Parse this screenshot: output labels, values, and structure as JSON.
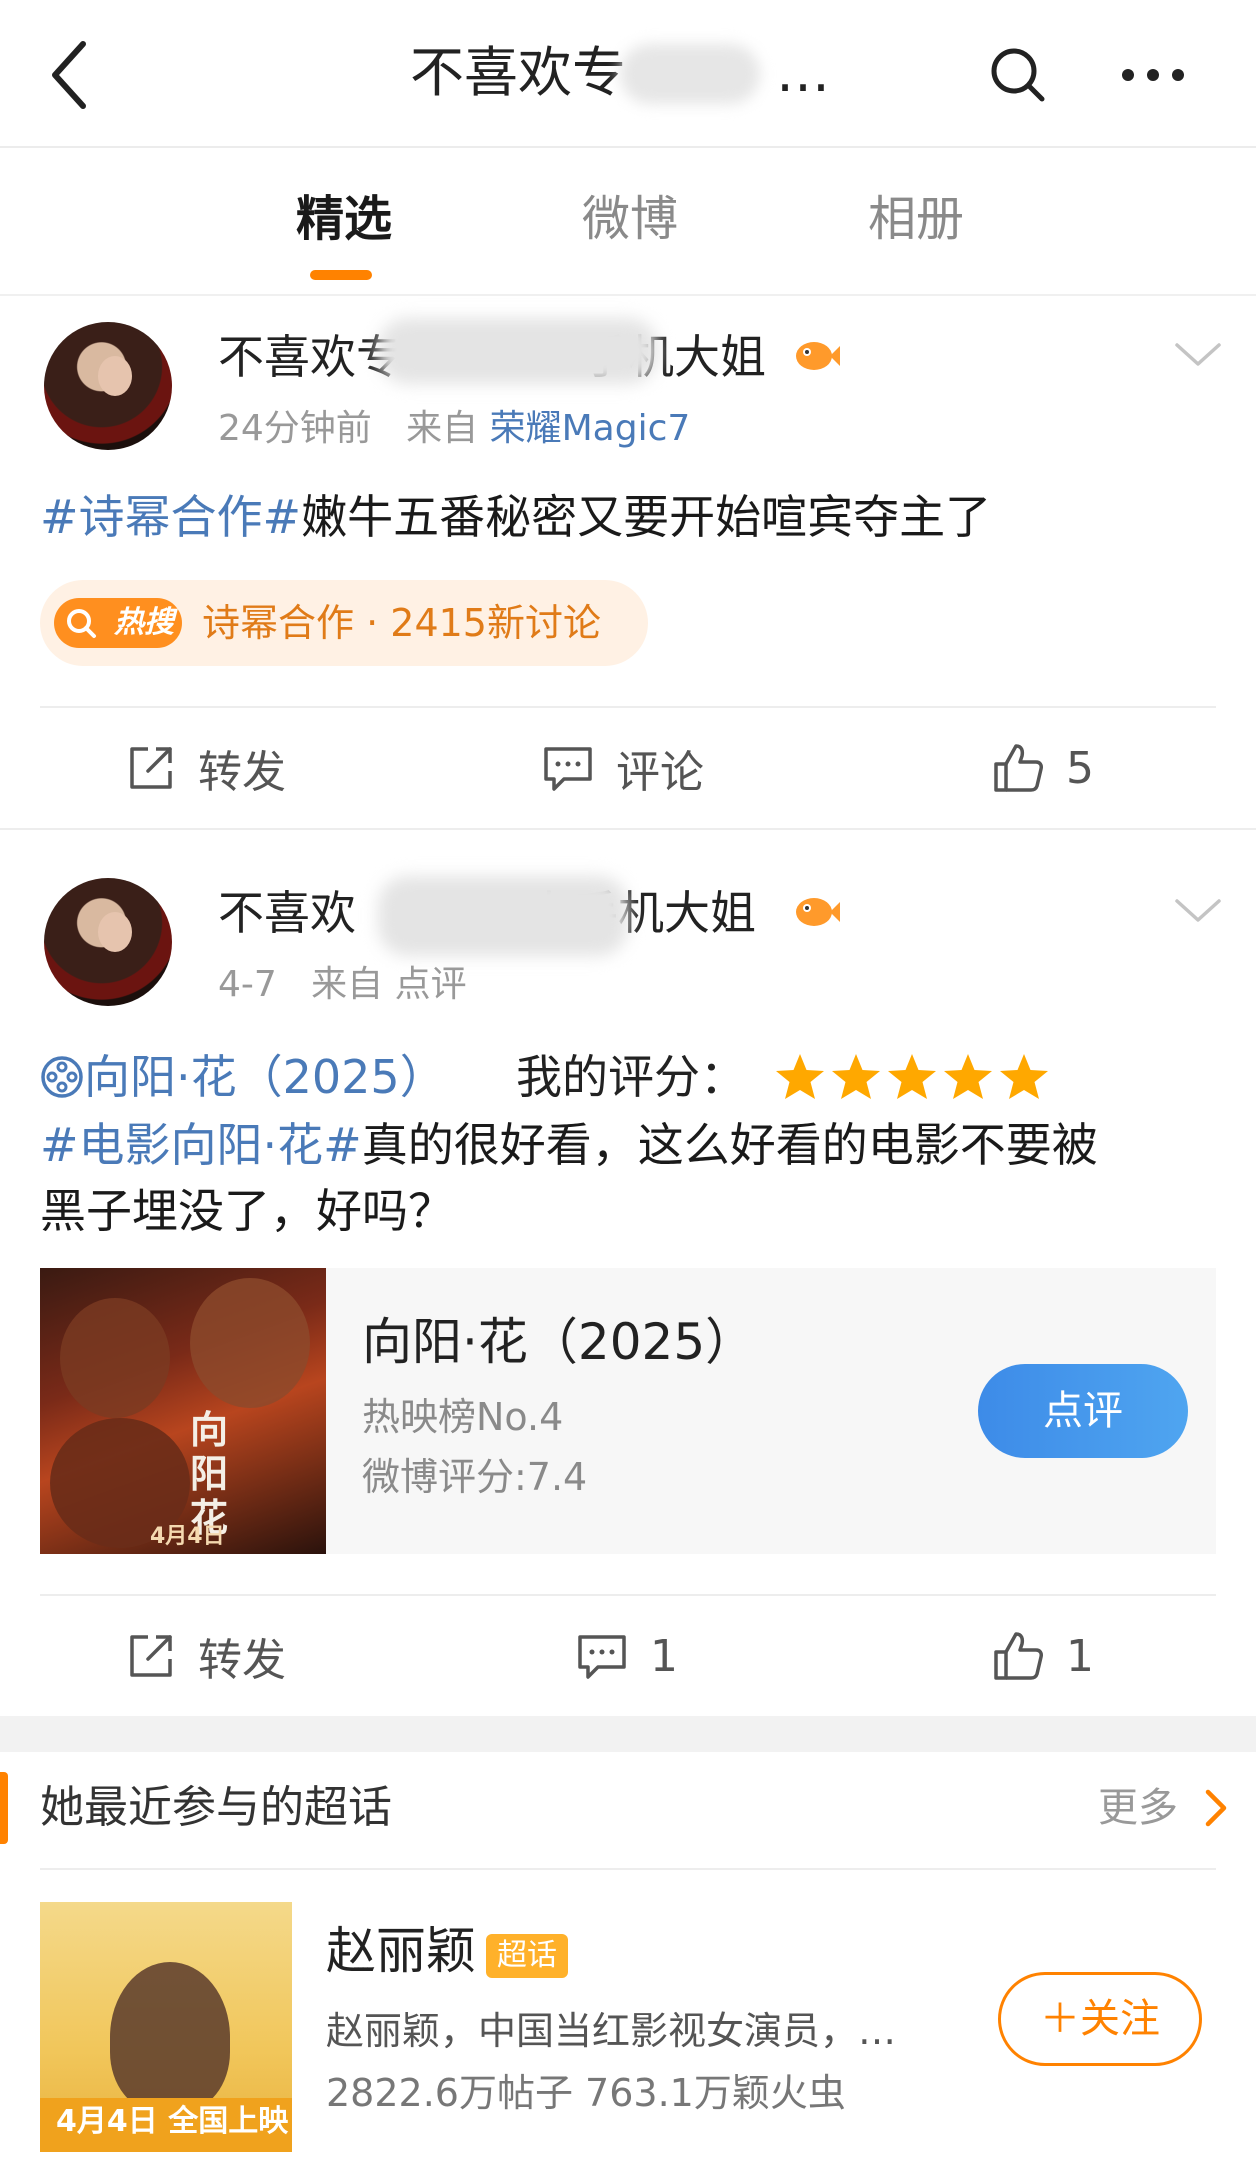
{
  "header": {
    "title": "不喜欢专",
    "title_ellipsis": "…",
    "back_icon": "chevron-left-icon",
    "search_icon": "search-icon",
    "more_icon": "more-horizontal-icon"
  },
  "tabs": [
    {
      "label": "精选",
      "active": true
    },
    {
      "label": "微博",
      "active": false
    },
    {
      "label": "相册",
      "active": false
    }
  ],
  "posts": [
    {
      "user": {
        "name_start": "不喜欢专",
        "name_end": "手机大姐"
      },
      "time": "24分钟前",
      "source_prefix": "来自",
      "source": "荣耀Magic7",
      "topic": "#诗幂合作#",
      "text": "嫩牛五番秘密又要开始喧宾夺主了",
      "hot": {
        "badge": "热搜",
        "topic": "诗幂合作",
        "discussion": "· 2415新讨论"
      },
      "actions": {
        "repost": "转发",
        "comment": "评论",
        "like": "5"
      }
    },
    {
      "user": {
        "name_start": "不喜欢",
        "name_end": "人手机大姐"
      },
      "time": "4-7",
      "source_prefix": "来自",
      "source": "点评",
      "movie_ref": "向阳·花（2025）",
      "my_rating_label": "我的评分：",
      "rating_stars": 5,
      "topic": "#电影向阳·花#",
      "text_line1": "真的很好看，这么好看的电影不要被",
      "text_line2": "黑子埋没了，好吗？",
      "movie_card": {
        "title": "向阳·花（2025）",
        "rank": "热映榜No.4",
        "score": "微博评分:7.4",
        "button": "点评",
        "poster_title": "向阳花",
        "poster_date": "4月4日"
      },
      "actions": {
        "repost": "转发",
        "comment": "1",
        "like": "1"
      }
    }
  ],
  "super_topics": {
    "section_title": "她最近参与的超话",
    "more_label": "更多",
    "item": {
      "name": "赵丽颖",
      "tag": "超话",
      "description": "赵丽颖，中国当红影视女演员，…",
      "stats": "2822.6万帖子 763.1万颖火虫",
      "follow_button": "＋关注",
      "cover_text": "4月4日 全国上映"
    }
  },
  "colors": {
    "accent": "#ff8200",
    "link": "#4a7ab8",
    "primary_button": "#3d8be8",
    "star": "#ffa800"
  }
}
